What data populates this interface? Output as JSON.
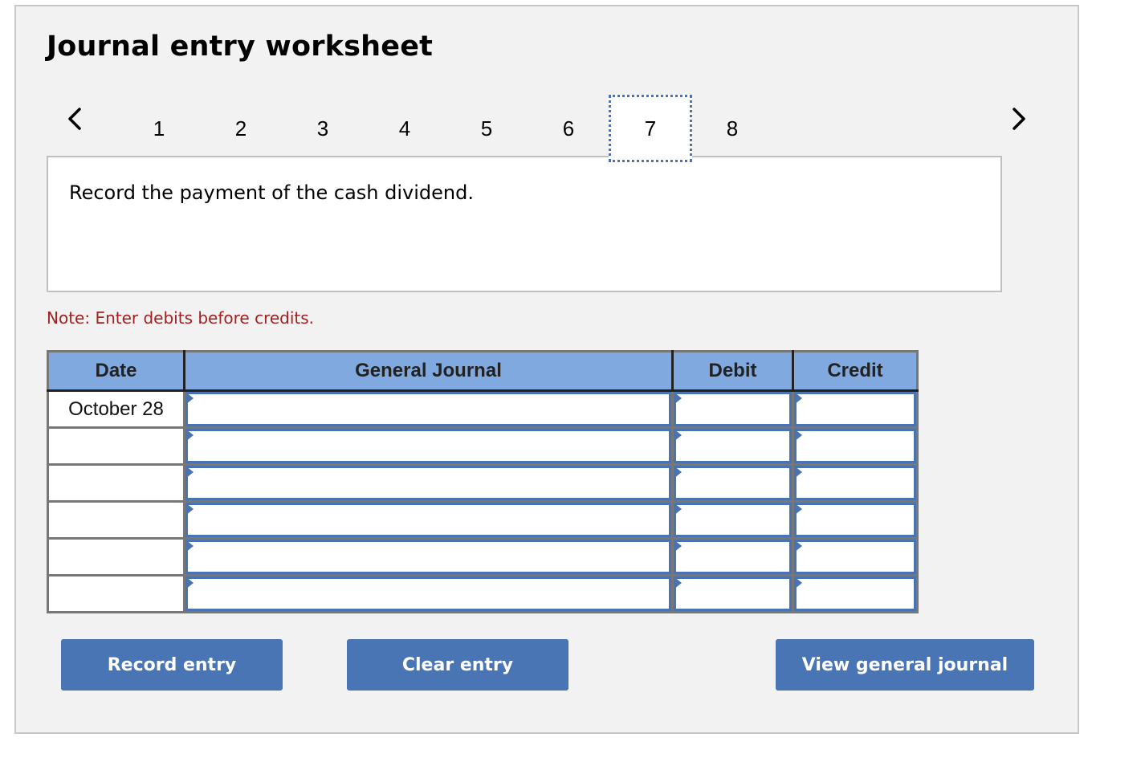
{
  "worksheet": {
    "title": "Journal entry worksheet",
    "nav": {
      "prev_icon": "chevron-left-icon",
      "next_icon": "chevron-right-icon",
      "tabs": [
        "1",
        "2",
        "3",
        "4",
        "5",
        "6",
        "7",
        "8"
      ],
      "active_tab": "7"
    },
    "prompt": "Record the payment of the cash dividend.",
    "note": "Note: Enter debits before credits.",
    "table": {
      "headers": {
        "date": "Date",
        "account": "General Journal",
        "debit": "Debit",
        "credit": "Credit"
      },
      "rows": [
        {
          "date": "October 28",
          "account": "",
          "debit": "",
          "credit": ""
        },
        {
          "date": "",
          "account": "",
          "debit": "",
          "credit": ""
        },
        {
          "date": "",
          "account": "",
          "debit": "",
          "credit": ""
        },
        {
          "date": "",
          "account": "",
          "debit": "",
          "credit": ""
        },
        {
          "date": "",
          "account": "",
          "debit": "",
          "credit": ""
        },
        {
          "date": "",
          "account": "",
          "debit": "",
          "credit": ""
        }
      ]
    },
    "buttons": {
      "record": "Record entry",
      "clear": "Clear entry",
      "view": "View general journal"
    },
    "colors": {
      "accent": "#4a75b4",
      "header_bg": "#80aadf",
      "note": "#a32020",
      "panel_bg": "#f2f2f2"
    }
  }
}
